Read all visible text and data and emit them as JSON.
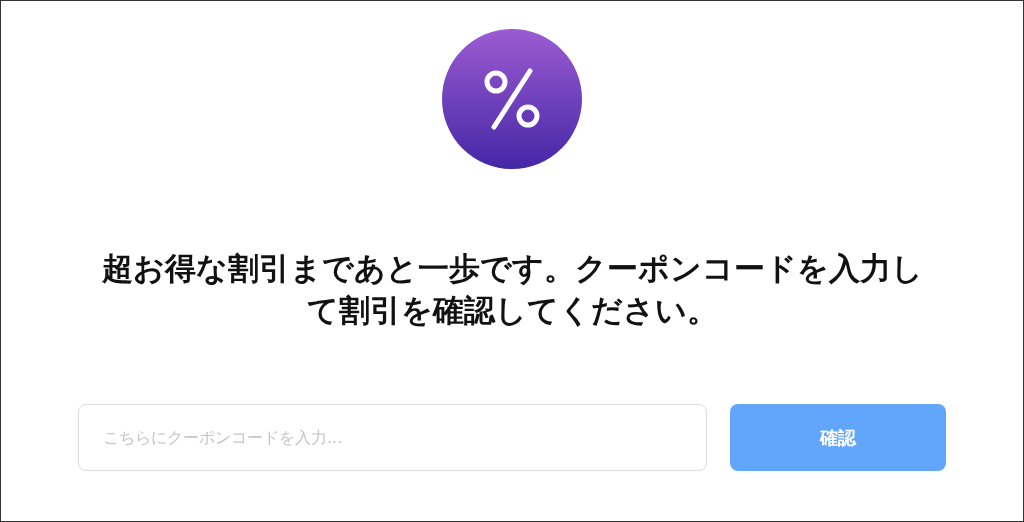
{
  "message": "超お得な割引まであと一歩です。クーポンコードを入力して割引を確認してください。",
  "coupon_field": {
    "placeholder": "こちらにクーポンコードを入力..."
  },
  "confirm_button": {
    "label": "確認"
  }
}
